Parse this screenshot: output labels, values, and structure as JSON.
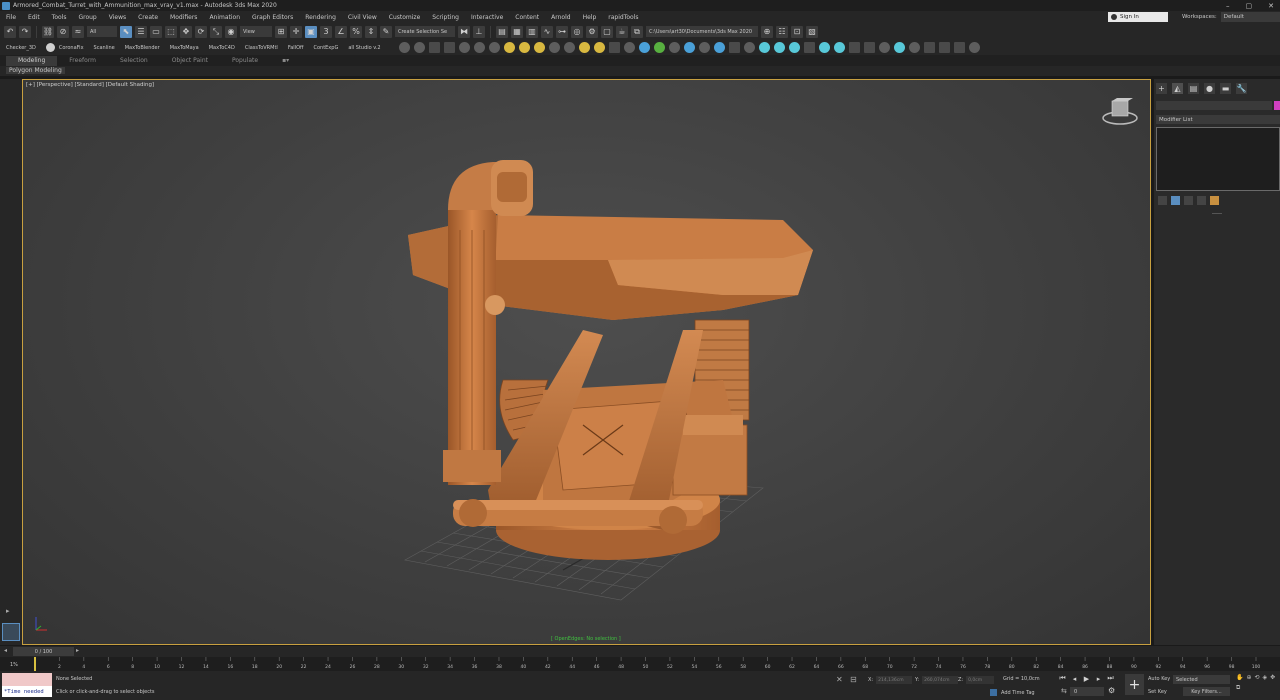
{
  "window": {
    "title": "Armored_Combat_Turret_with_Ammunition_max_vray_v1.max - Autodesk 3ds Max 2020",
    "minimize": "–",
    "maximize": "▢",
    "close": "✕"
  },
  "menu": [
    "File",
    "Edit",
    "Tools",
    "Group",
    "Views",
    "Create",
    "Modifiers",
    "Animation",
    "Graph Editors",
    "Rendering",
    "Civil View",
    "Customize",
    "Scripting",
    "Interactive",
    "Content",
    "Arnold",
    "Help",
    "rapidTools"
  ],
  "account": {
    "sign_in": "Sign In",
    "workspaces_label": "Workspaces:",
    "workspaces_value": "Default"
  },
  "toolbar": {
    "filter": "All",
    "ref_coord": "View",
    "selection_set": "Create Selection Se",
    "project_path": "C:\\Users\\art30\\Documents\\3ds Max 2020"
  },
  "shelf": [
    "Checker_3D",
    "CoronaFix",
    "Scanline",
    "MaxToBlender",
    "MaxToMaya",
    "MaxToC4D",
    "ClassToVRMtl",
    "FallOff",
    "ContExpG",
    "all Studio v.2"
  ],
  "ribbon": {
    "tabs": [
      "Modeling",
      "Freeform",
      "Selection",
      "Object Paint",
      "Populate"
    ],
    "extra": "▪▾",
    "sub_label": "Polygon Modeling"
  },
  "viewport": {
    "label": "[+] [Perspective] [Standard] [Default Shading]",
    "status": "[ OpenEdges: No selection ]"
  },
  "command_panel": {
    "tab_icons": [
      "plus-icon",
      "modify-icon",
      "hierarchy-icon",
      "motion-icon",
      "display-icon",
      "utilities-icon"
    ],
    "tab_glyphs": [
      "+",
      "◭",
      "▤",
      "●",
      "▬",
      "🔧"
    ],
    "modifier_list": "Modifier List",
    "accent": "#d040c0"
  },
  "timeline": {
    "frame_readout": "0 / 100",
    "ticks": [
      "0",
      "2",
      "4",
      "6",
      "8",
      "10",
      "12",
      "14",
      "16",
      "18",
      "20",
      "22",
      "24",
      "26",
      "28",
      "30",
      "32",
      "34",
      "36",
      "38",
      "40",
      "42",
      "44",
      "46",
      "48",
      "50",
      "52",
      "54",
      "56",
      "58",
      "60",
      "62",
      "64",
      "66",
      "68",
      "70",
      "72",
      "74",
      "76",
      "78",
      "80",
      "82",
      "84",
      "86",
      "88",
      "90",
      "92",
      "94",
      "96",
      "98",
      "100"
    ],
    "corner_label": "1%"
  },
  "status": {
    "maxscript_output": "*Time needed",
    "selection": "None Selected",
    "prompt": "Click or click-and-drag to select objects",
    "x_label": "X:",
    "x_value": "214,136cm",
    "y_label": "Y:",
    "y_value": "260,074cm",
    "z_label": "Z:",
    "z_value": "0,0cm",
    "grid": "Grid = 10,0cm",
    "add_time_tag": "Add Time Tag",
    "frame": "0",
    "auto_key": "Auto Key",
    "set_key": "Set Key",
    "selected": "Selected",
    "key_filters": "Key Filters..."
  },
  "colors": {
    "model": "#c87a42",
    "viewport_border": "#c8a040",
    "status_green": "#40c040",
    "selection_blue": "#5a8ec0"
  }
}
